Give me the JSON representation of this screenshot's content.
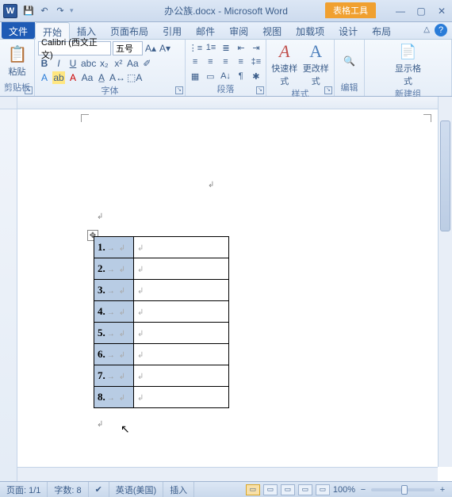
{
  "title": "办公族.docx - Microsoft Word",
  "context_tool": "表格工具",
  "win": {
    "min": "▭",
    "max": "▢",
    "close": "✕"
  },
  "tabs": {
    "file": "文件",
    "home": "开始",
    "insert": "插入",
    "layout": "页面布局",
    "ref": "引用",
    "mail": "邮件",
    "review": "审阅",
    "view": "视图",
    "addin": "加载项",
    "design": "设计",
    "tlayout": "布局"
  },
  "ribbon": {
    "clipboard": {
      "paste": "粘贴",
      "label": "剪贴板"
    },
    "font": {
      "name": "Calibri (西文正文)",
      "size": "五号",
      "label": "字体"
    },
    "paragraph": {
      "label": "段落"
    },
    "styles": {
      "quick": "快速样式",
      "change": "更改样式",
      "label": "样式"
    },
    "editing": {
      "label": "编辑"
    },
    "newgrp": {
      "show": "显示格式",
      "label": "新建组"
    }
  },
  "table": {
    "rows": [
      {
        "n": "1."
      },
      {
        "n": "2."
      },
      {
        "n": "3."
      },
      {
        "n": "4."
      },
      {
        "n": "5."
      },
      {
        "n": "6."
      },
      {
        "n": "7."
      },
      {
        "n": "8."
      }
    ]
  },
  "status": {
    "page": "页面: 1/1",
    "words": "字数: 8",
    "lang": "英语(美国)",
    "mode": "插入",
    "zoom": "100%"
  },
  "marks": {
    "arrow": "→",
    "pm": "↲",
    "plus": "✥"
  }
}
